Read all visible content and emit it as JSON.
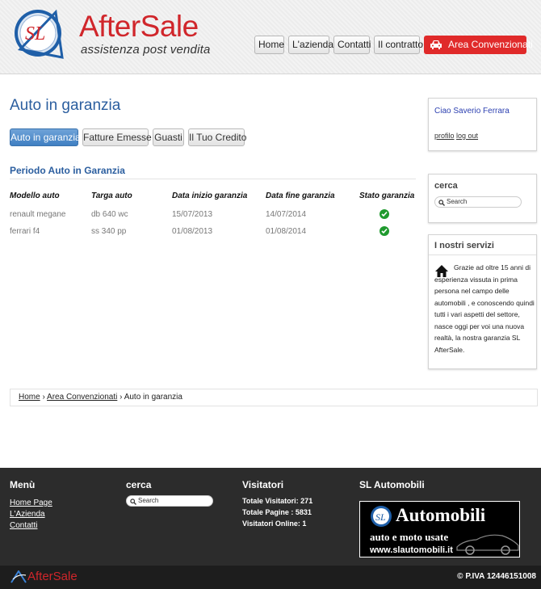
{
  "header": {
    "logo_text": "AfterSale",
    "logo_sub": "assistenza post vendita",
    "nav": [
      "Home",
      "L'azienda",
      "Contatti",
      "Il contratto"
    ],
    "nav_highlight": "Area Convenzionati",
    "nav_highlight_icon": "car-icon"
  },
  "main": {
    "title": "Auto in garanzia",
    "tabs": [
      "Auto in garanzia",
      "Fatture Emesse",
      "Guasti",
      "Il Tuo Credito"
    ],
    "active_tab": "Auto in garanzia",
    "section_title": "Periodo Auto in Garanzia",
    "table": {
      "headers": [
        "Modello auto",
        "Targa auto",
        "Data inizio garanzia",
        "Data fine garanzia",
        "Stato garanzia"
      ],
      "rows": [
        {
          "model": "renault megane",
          "plate": "db 640 wc",
          "start": "15/07/2013",
          "end": "14/07/2014",
          "status": "ok"
        },
        {
          "model": "ferrari f4",
          "plate": "ss 340 pp",
          "start": "01/08/2013",
          "end": "01/08/2014",
          "status": "ok"
        }
      ]
    }
  },
  "sidebar": {
    "greeting": "Ciao Saverio Ferrara",
    "profile_link": "profilo",
    "logout_link": "log out",
    "search_title": "cerca",
    "search_placeholder": "Search",
    "services_title": "I nostri servizi",
    "services_text": "Grazie ad oltre 15 anni di esperienza vissuta in prima persona nel campo delle automobili , e conoscendo quindi tutti i vari aspetti del settore, nasce oggi per voi una nuova realtà, la nostra garanzia SL AfterSale."
  },
  "breadcrumb": {
    "items": [
      "Home",
      "Area Convenzionati",
      "Auto in garanzia"
    ],
    "separator": "›"
  },
  "footer": {
    "menu_title": "Menù",
    "menu_links": [
      "Home Page",
      "L'Azienda",
      "Contatti"
    ],
    "search_title": "cerca",
    "search_placeholder": "Search",
    "visitors_title": "Visitatori",
    "visitors": [
      "Totale Visitatori: 271",
      "Totale Pagine : 5831",
      "Visitatori Online: 1"
    ],
    "partner_title": "SL Automobili",
    "banner_title": "Automobili",
    "banner_sub": "auto e moto usate",
    "banner_url": "www.slautomobili.it",
    "bottom_logo": "AfterSale",
    "copyright": "© P.IVA 12446151008"
  },
  "colors": {
    "brand_red": "#d0262b",
    "link_blue": "#2b5e9f",
    "active_tab": "#4a88c8",
    "ok_green": "#1f9a2e",
    "footer_bg": "#2c2c2c"
  }
}
